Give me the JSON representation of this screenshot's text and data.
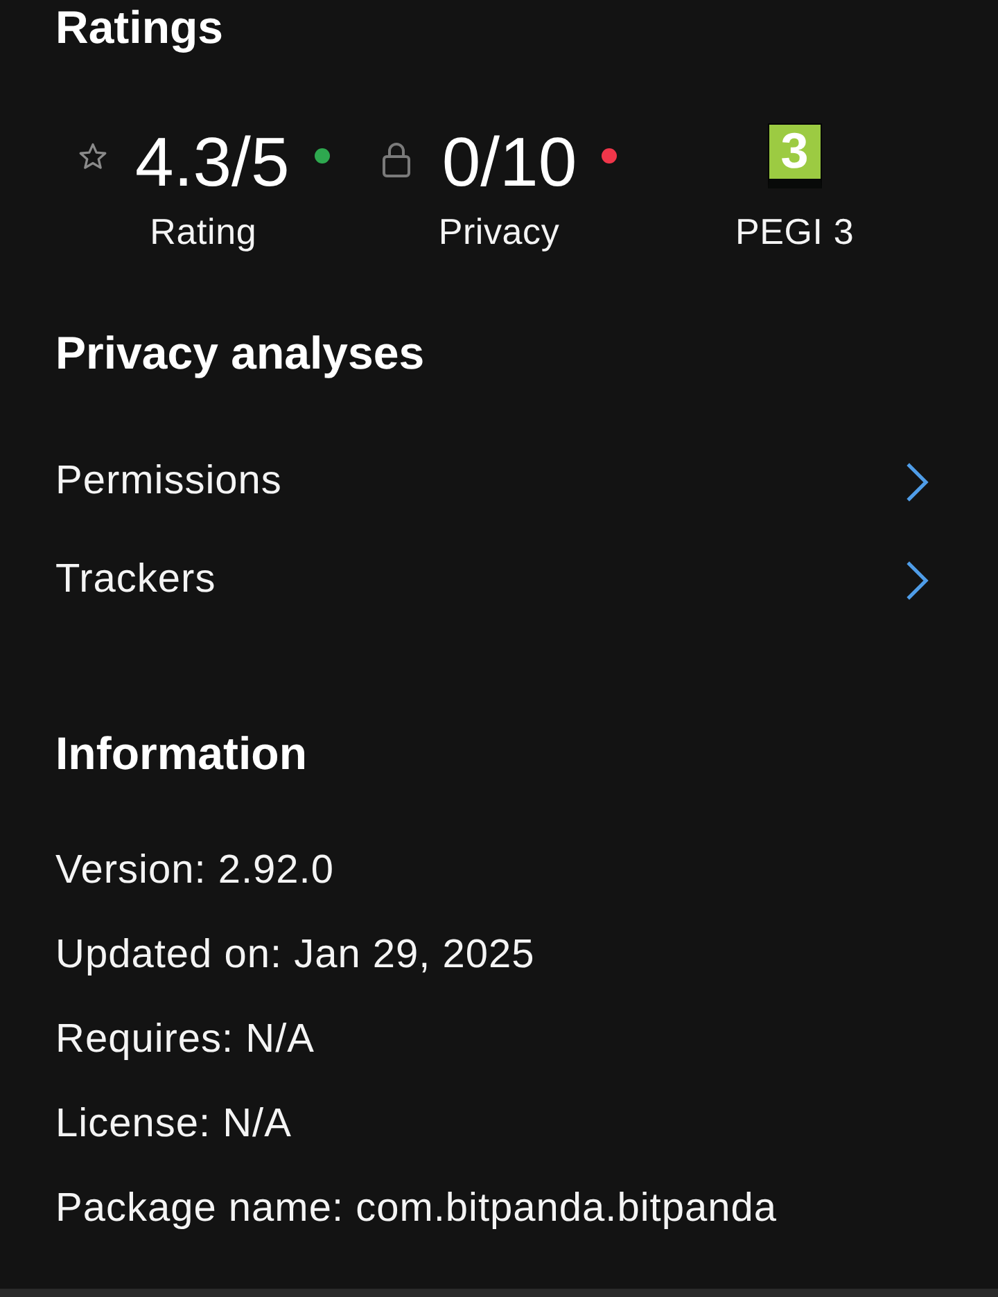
{
  "ratings": {
    "title": "Ratings",
    "items": [
      {
        "kind": "rating",
        "value": "4.3/5",
        "color": "#2ea84f",
        "label": "Rating"
      },
      {
        "kind": "privacy",
        "value": "0/10",
        "color": "#f0364a",
        "label": "Privacy"
      },
      {
        "kind": "age",
        "badge": "3",
        "label": "PEGI 3"
      }
    ]
  },
  "privacy_analyses": {
    "title": "Privacy analyses",
    "items": [
      {
        "label": "Permissions"
      },
      {
        "label": "Trackers"
      }
    ]
  },
  "information": {
    "title": "Information",
    "lines": [
      "Version: 2.92.0",
      "Updated on: Jan 29, 2025",
      "Requires: N/A",
      "License: N/A",
      "Package name: com.bitpanda.bitpanda"
    ]
  }
}
